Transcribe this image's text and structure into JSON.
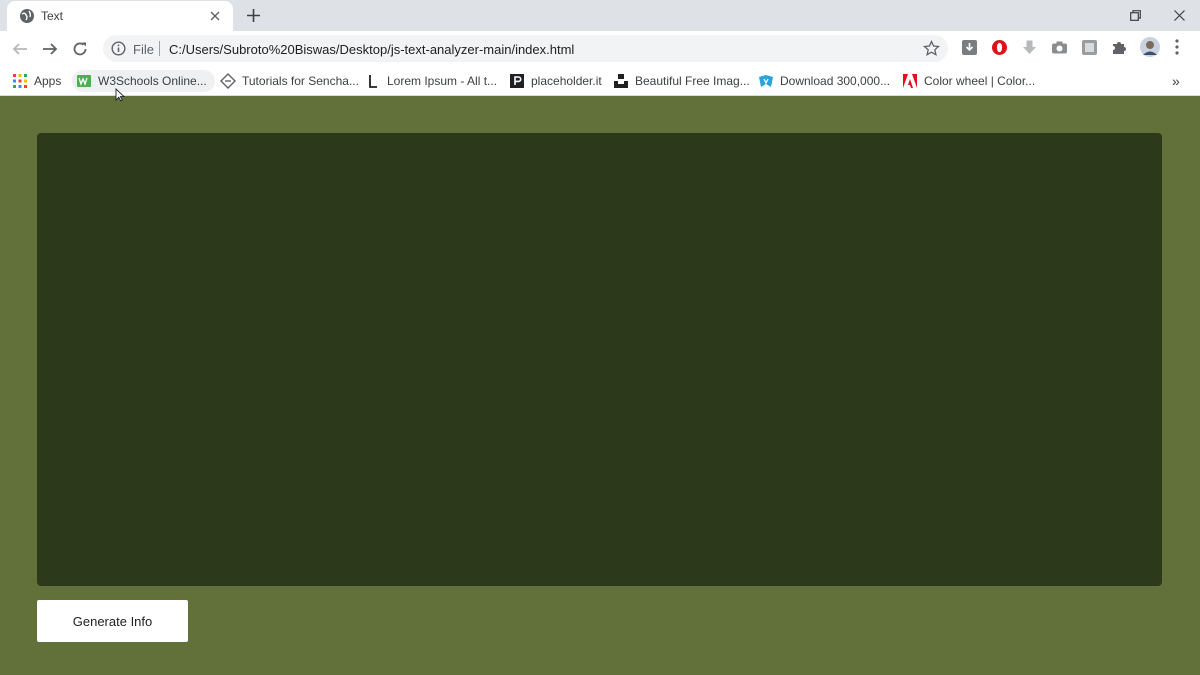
{
  "browser": {
    "tab": {
      "title": "Text"
    },
    "address_bar": {
      "scheme_label": "File",
      "url": "C:/Users/Subroto%20Biswas/Desktop/js-text-analyzer-main/index.html"
    },
    "bookmarks": [
      {
        "label": "Apps",
        "icon": "apps-grid-icon"
      },
      {
        "label": "W3Schools Online...",
        "icon": "w3schools-icon"
      },
      {
        "label": "Tutorials for Sencha...",
        "icon": "sencha-icon"
      },
      {
        "label": "Lorem Ipsum - All t...",
        "icon": "lorem-ipsum-icon"
      },
      {
        "label": "placeholder.it",
        "icon": "placeholder-icon"
      },
      {
        "label": "Beautiful Free Imag...",
        "icon": "unsplash-icon"
      },
      {
        "label": "Download 300,000...",
        "icon": "download-site-icon"
      },
      {
        "label": "Color wheel | Color...",
        "icon": "adobe-color-icon"
      }
    ],
    "overflow_label": "»"
  },
  "page": {
    "textarea_value": "",
    "generate_button_label": "Generate Info"
  },
  "colors": {
    "page_background": "#62703a",
    "textarea_background": "#2d391b",
    "button_background": "#ffffff"
  }
}
